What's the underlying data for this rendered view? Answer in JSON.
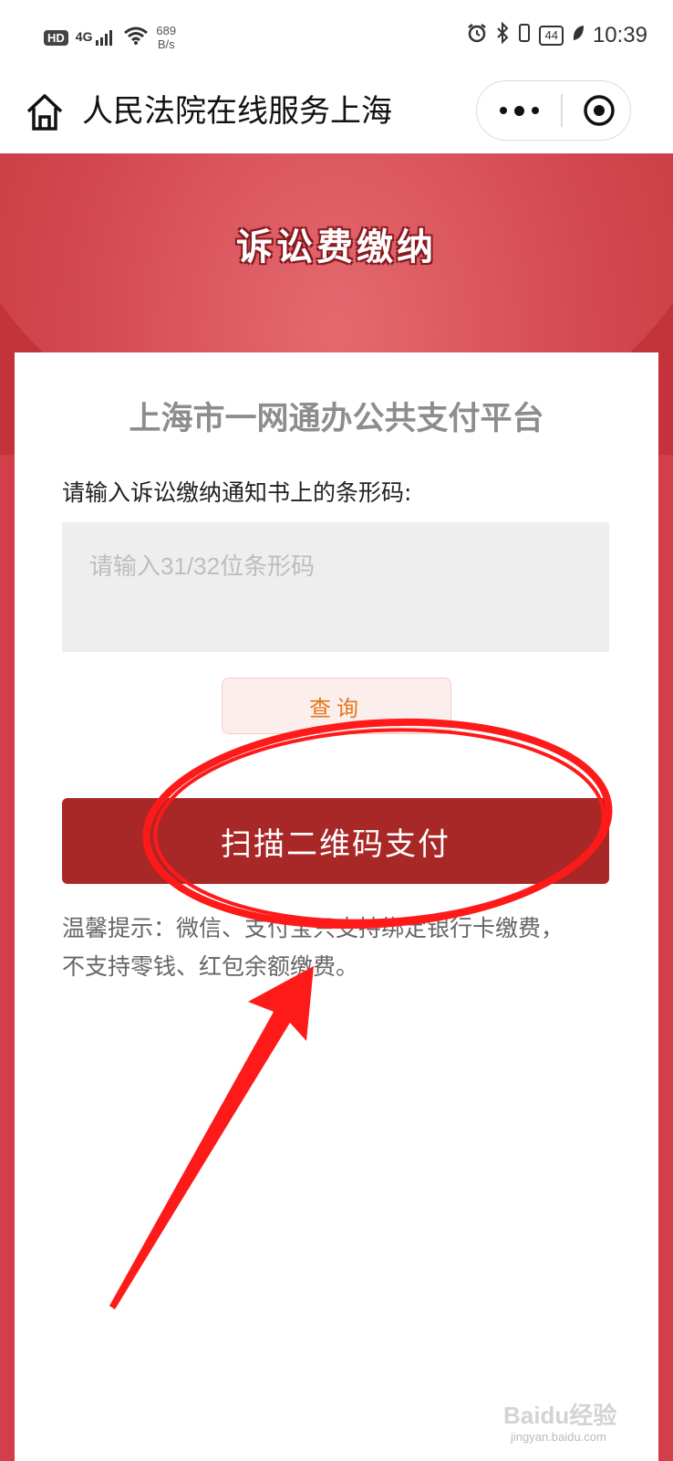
{
  "status_bar": {
    "hd": "HD",
    "signal": "4G",
    "net_speed_value": "689",
    "net_speed_unit": "B/s",
    "battery": "44",
    "time": "10:39"
  },
  "navbar": {
    "title": "人民法院在线服务上海"
  },
  "banner": {
    "title": "诉讼费缴纳"
  },
  "form": {
    "platform_title": "上海市一网通办公共支付平台",
    "prompt": "请输入诉讼缴纳通知书上的条形码:",
    "input_placeholder": "请输入31/32位条形码",
    "query_label": "查询",
    "scan_label": "扫描二维码支付",
    "tip": "温馨提示：微信、支付宝只支持绑定银行卡缴费，不支持零钱、红包余额缴费。"
  },
  "watermark": {
    "brand": "Baidu经验",
    "url": "jingyan.baidu.com"
  },
  "colors": {
    "banner_red": "#c4323a",
    "page_red": "#d23f4a",
    "scan_button": "#a82727",
    "query_text": "#e07818",
    "annotation": "#ff1a1a"
  }
}
